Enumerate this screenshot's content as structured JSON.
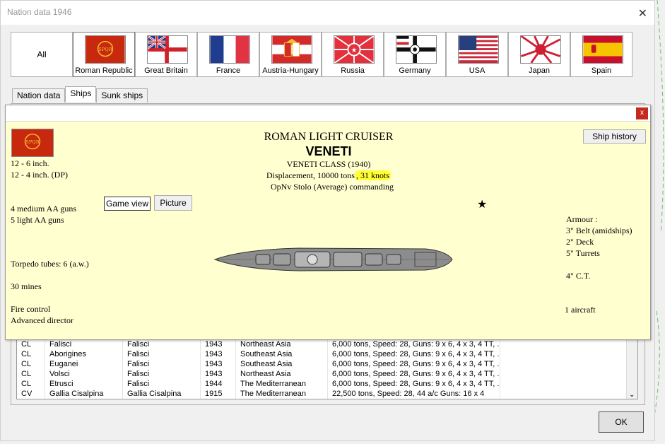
{
  "window": {
    "title": "Nation data 1946"
  },
  "nations": [
    {
      "label": "All",
      "flag": "none"
    },
    {
      "label": "Roman Republic",
      "flag": "roman-flag"
    },
    {
      "label": "Great Britain",
      "flag": "british-ensign"
    },
    {
      "label": "France",
      "flag": "french-tricolor"
    },
    {
      "label": "Austria-Hungary",
      "flag": "austro-hungarian-flag"
    },
    {
      "label": "Russia",
      "flag": "russian-flag"
    },
    {
      "label": "Germany",
      "flag": "german-war-ensign"
    },
    {
      "label": "USA",
      "flag": "us-flag"
    },
    {
      "label": "Japan",
      "flag": "rising-sun-flag"
    },
    {
      "label": "Spain",
      "flag": "spanish-flag"
    }
  ],
  "subtabs": [
    "Nation data",
    "Ships",
    "Sunk ships"
  ],
  "table": {
    "rows": [
      [
        "CL",
        "Falisci",
        "Falisci",
        "1943",
        "Northeast Asia",
        "6,000 tons, Speed: 28, Guns: 9 x 6, 4 x 3, 4 TT, ..."
      ],
      [
        "CL",
        "Aborigines",
        "Falisci",
        "1943",
        "Southeast Asia",
        "6,000 tons, Speed: 28, Guns: 9 x 6, 4 x 3, 4 TT, ..."
      ],
      [
        "CL",
        "Euganei",
        "Falisci",
        "1943",
        "Southeast Asia",
        "6,000 tons, Speed: 28, Guns: 9 x 6, 4 x 3, 4 TT, ..."
      ],
      [
        "CL",
        "Volsci",
        "Falisci",
        "1943",
        "Northeast Asia",
        "6,000 tons, Speed: 28, Guns: 9 x 6, 4 x 3, 4 TT, ..."
      ],
      [
        "CL",
        "Etrusci",
        "Falisci",
        "1944",
        "The Mediterranean",
        "6,000 tons, Speed: 28, Guns: 9 x 6, 4 x 3, 4 TT, ..."
      ],
      [
        "CV",
        "Gallia Cisalpina",
        "Gallia Cisalpina",
        "1915",
        "The Mediterranean",
        "22,500 tons, Speed: 28, 44 a/c Guns: 16 x 4"
      ]
    ]
  },
  "ok_label": "OK",
  "popup": {
    "ship_type": "ROMAN LIGHT CRUISER",
    "ship_name": "VENETI",
    "ship_class": "VENETI CLASS (1940)",
    "displacement": "Displacement, 10000 tons",
    "speed": ", 31 knots",
    "commander": "OpNv Stolo (Average)  commanding",
    "ship_history_label": "Ship history",
    "game_view_label": "Game view",
    "picture_label": "Picture",
    "close_label": "x",
    "star": "★",
    "guns_main": "12 - 6 inch.",
    "guns_dp": "12 - 4 inch. (DP)",
    "aa_medium": "4 medium AA guns",
    "aa_light": "5 light AA guns",
    "torpedo": "Torpedo tubes: 6 (a.w.)",
    "mines": "30 mines",
    "fire_control": "Fire control",
    "director": "Advanced director",
    "armour_title": "Armour :",
    "armour_belt": "3\" Belt (amidships)",
    "armour_deck": "2\" Deck",
    "armour_turrets": "5\" Turrets",
    "armour_ct": "4\" C.T.",
    "aircraft": "1 aircraft",
    "flag_text": "SPQR"
  }
}
